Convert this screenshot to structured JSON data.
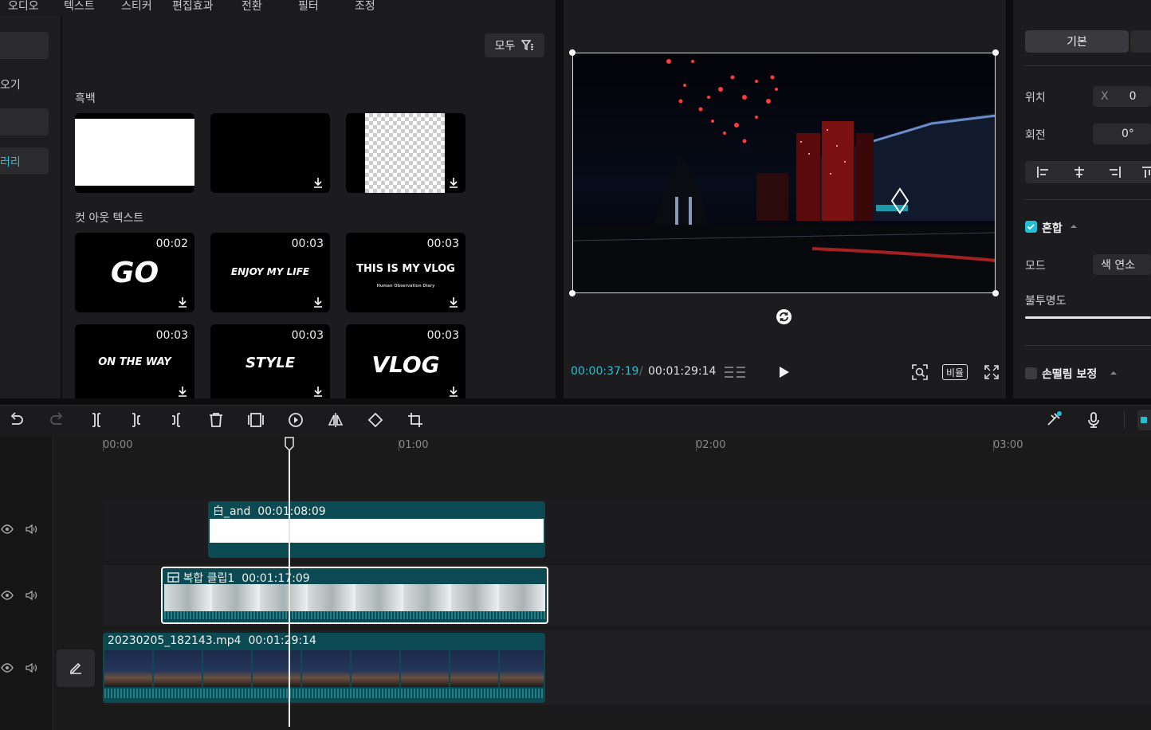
{
  "tabs": [
    "오디오",
    "텍스트",
    "스티커",
    "편집효과",
    "전환",
    "필터",
    "조정"
  ],
  "left_categories": [
    "오기",
    "러리"
  ],
  "content": {
    "filter_label": "모두",
    "section1_title": "흑백",
    "section2_title": "컷 아웃 텍스트",
    "templates": [
      {
        "duration": "00:02",
        "text": "GO"
      },
      {
        "duration": "00:03",
        "text": "ENJOY MY LIFE"
      },
      {
        "duration": "00:03",
        "text": "THIS IS MY VLOG"
      },
      {
        "duration": "00:03",
        "text": "ON THE WAY"
      },
      {
        "duration": "00:03",
        "text": "STYLE"
      },
      {
        "duration": "00:03",
        "text": "VLOG"
      }
    ],
    "vlog_sub": "Human Observation Diary"
  },
  "preview": {
    "current_time": "00:00:37:19",
    "separator": "/",
    "total_time": "00:01:29:14",
    "ratio_label": "비율"
  },
  "props": {
    "tab_basic": "기본",
    "position_label": "위치",
    "position_x_label": "X",
    "position_x_value": "0",
    "rotation_label": "회전",
    "rotation_value": "0°",
    "blend_label": "혼합",
    "mode_label": "모드",
    "mode_value": "색 연소",
    "opacity_label": "불투명도",
    "stabilize_label": "손떨림 보정"
  },
  "timeline": {
    "ruler": [
      "00:00",
      "01:00",
      "02:00",
      "03:00"
    ],
    "clips": [
      {
        "name": "白_and",
        "duration": "00:01:08:09"
      },
      {
        "name": "복합 클립1",
        "duration": "00:01:17:09"
      },
      {
        "name": "20230205_182143.mp4",
        "duration": "00:01:29:14"
      }
    ]
  },
  "colors": {
    "accent": "#1fc0d6",
    "clip": "#0b4a52",
    "panel": "#1c1c1e"
  }
}
